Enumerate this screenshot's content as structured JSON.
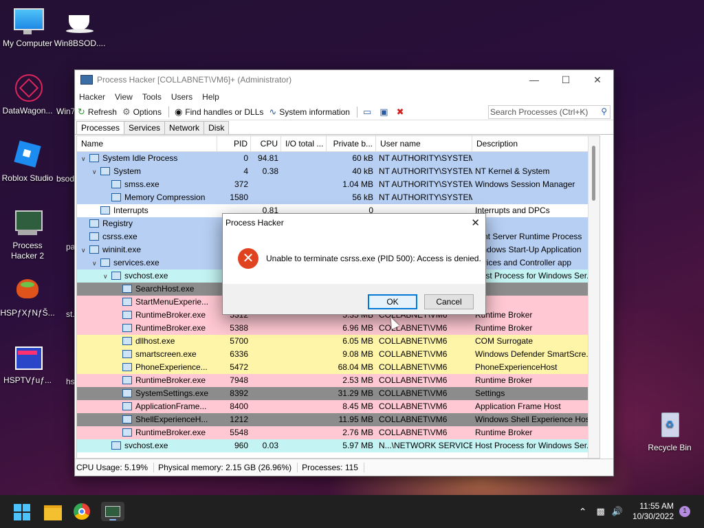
{
  "desktop": {
    "icons": [
      {
        "label": "My Computer"
      },
      {
        "label": "Win8BSOD...."
      },
      {
        "label": "DataWagon..."
      },
      {
        "label": "Roblox Studio"
      },
      {
        "label": "Process Hacker 2"
      },
      {
        "label": "HSPƒXƒNƒŠ..."
      },
      {
        "label": "HSPTVƒuƒ..."
      },
      {
        "label": "Recycle Bin"
      }
    ],
    "partial_labels": [
      "Win7...",
      "bsod...",
      "pa...",
      "st...",
      "hs..."
    ]
  },
  "window": {
    "title": "Process Hacker [COLLABNET\\VM6]+ (Administrator)",
    "menu": [
      "Hacker",
      "View",
      "Tools",
      "Users",
      "Help"
    ],
    "toolbar": {
      "refresh": "Refresh",
      "options": "Options",
      "find_handles": "Find handles or DLLs",
      "system_info": "System information",
      "search_placeholder": "Search Processes (Ctrl+K)"
    },
    "tabs": [
      "Processes",
      "Services",
      "Network",
      "Disk"
    ],
    "columns": [
      "Name",
      "PID",
      "CPU",
      "I/O total ...",
      "Private b...",
      "User name",
      "Description"
    ],
    "rows": [
      {
        "name": "System Idle Process",
        "pid": "0",
        "cpu": "94.81",
        "io": "",
        "priv": "60 kB",
        "user": "NT AUTHORITY\\SYSTEM",
        "desc": "",
        "color": "#b7cff3",
        "indent": 0,
        "exp": "v"
      },
      {
        "name": "System",
        "pid": "4",
        "cpu": "0.38",
        "io": "",
        "priv": "40 kB",
        "user": "NT AUTHORITY\\SYSTEM",
        "desc": "NT Kernel & System",
        "color": "#b7cff3",
        "indent": 1,
        "exp": "v"
      },
      {
        "name": "smss.exe",
        "pid": "372",
        "cpu": "",
        "io": "",
        "priv": "1.04 MB",
        "user": "NT AUTHORITY\\SYSTEM",
        "desc": "Windows Session Manager",
        "color": "#b7cff3",
        "indent": 2,
        "exp": ""
      },
      {
        "name": "Memory Compression",
        "pid": "1580",
        "cpu": "",
        "io": "",
        "priv": "56 kB",
        "user": "NT AUTHORITY\\SYSTEM",
        "desc": "",
        "color": "#b7cff3",
        "indent": 2,
        "exp": ""
      },
      {
        "name": "Interrupts",
        "pid": "",
        "cpu": "0.81",
        "io": "",
        "priv": "0",
        "user": "",
        "desc": "Interrupts and DPCs",
        "color": "#ffffff",
        "indent": 1,
        "exp": ""
      },
      {
        "name": "Registry",
        "pid": "",
        "cpu": "",
        "io": "",
        "priv": "",
        "user": "",
        "desc": "",
        "color": "#b7cff3",
        "indent": 0,
        "exp": ""
      },
      {
        "name": "csrss.exe",
        "pid": "",
        "cpu": "",
        "io": "",
        "priv": "",
        "user": "",
        "desc": "lient Server Runtime Process",
        "color": "#b7cff3",
        "indent": 0,
        "exp": ""
      },
      {
        "name": "wininit.exe",
        "pid": "",
        "cpu": "",
        "io": "",
        "priv": "",
        "user": "",
        "desc": "Vindows Start-Up Application",
        "color": "#b7cff3",
        "indent": 0,
        "exp": "v"
      },
      {
        "name": "services.exe",
        "pid": "",
        "cpu": "",
        "io": "",
        "priv": "",
        "user": "",
        "desc": "ervices and Controller app",
        "color": "#b7cff3",
        "indent": 1,
        "exp": "v"
      },
      {
        "name": "svchost.exe",
        "pid": "",
        "cpu": "",
        "io": "",
        "priv": "",
        "user": "",
        "desc": "Host Process for Windows Ser...",
        "color": "#c4f3f3",
        "indent": 2,
        "exp": "v"
      },
      {
        "name": "SearchHost.exe",
        "pid": "",
        "cpu": "",
        "io": "",
        "priv": "",
        "user": "",
        "desc": "",
        "color": "#8c8c8c",
        "indent": 3,
        "exp": ""
      },
      {
        "name": "StartMenuExperie...",
        "pid": "",
        "cpu": "",
        "io": "",
        "priv": "",
        "user": "",
        "desc": "",
        "color": "#ffc8d2",
        "indent": 3,
        "exp": ""
      },
      {
        "name": "RuntimeBroker.exe",
        "pid": "5312",
        "cpu": "",
        "io": "",
        "priv": "5.35 MB",
        "user": "COLLABNET\\VM6",
        "desc": "Runtime Broker",
        "color": "#ffc8d2",
        "indent": 3,
        "exp": ""
      },
      {
        "name": "RuntimeBroker.exe",
        "pid": "5388",
        "cpu": "",
        "io": "",
        "priv": "6.96 MB",
        "user": "COLLABNET\\VM6",
        "desc": "Runtime Broker",
        "color": "#ffc8d2",
        "indent": 3,
        "exp": ""
      },
      {
        "name": "dllhost.exe",
        "pid": "5700",
        "cpu": "",
        "io": "",
        "priv": "6.05 MB",
        "user": "COLLABNET\\VM6",
        "desc": "COM Surrogate",
        "color": "#fff5a8",
        "indent": 3,
        "exp": ""
      },
      {
        "name": "smartscreen.exe",
        "pid": "6336",
        "cpu": "",
        "io": "",
        "priv": "9.08 MB",
        "user": "COLLABNET\\VM6",
        "desc": "Windows Defender SmartScre...",
        "color": "#fff5a8",
        "indent": 3,
        "exp": ""
      },
      {
        "name": "PhoneExperience...",
        "pid": "5472",
        "cpu": "",
        "io": "",
        "priv": "68.04 MB",
        "user": "COLLABNET\\VM6",
        "desc": "PhoneExperienceHost",
        "color": "#fff5a8",
        "indent": 3,
        "exp": ""
      },
      {
        "name": "RuntimeBroker.exe",
        "pid": "7948",
        "cpu": "",
        "io": "",
        "priv": "2.53 MB",
        "user": "COLLABNET\\VM6",
        "desc": "Runtime Broker",
        "color": "#ffc8d2",
        "indent": 3,
        "exp": ""
      },
      {
        "name": "SystemSettings.exe",
        "pid": "8392",
        "cpu": "",
        "io": "",
        "priv": "31.29 MB",
        "user": "COLLABNET\\VM6",
        "desc": "Settings",
        "color": "#8c8c8c",
        "indent": 3,
        "exp": ""
      },
      {
        "name": "ApplicationFrame...",
        "pid": "8400",
        "cpu": "",
        "io": "",
        "priv": "8.45 MB",
        "user": "COLLABNET\\VM6",
        "desc": "Application Frame Host",
        "color": "#ffc8d2",
        "indent": 3,
        "exp": ""
      },
      {
        "name": "ShellExperienceH...",
        "pid": "1212",
        "cpu": "",
        "io": "",
        "priv": "11.95 MB",
        "user": "COLLABNET\\VM6",
        "desc": "Windows Shell Experience Host",
        "color": "#8c8c8c",
        "indent": 3,
        "exp": ""
      },
      {
        "name": "RuntimeBroker.exe",
        "pid": "5548",
        "cpu": "",
        "io": "",
        "priv": "2.76 MB",
        "user": "COLLABNET\\VM6",
        "desc": "Runtime Broker",
        "color": "#ffc8d2",
        "indent": 3,
        "exp": ""
      },
      {
        "name": "svchost.exe",
        "pid": "960",
        "cpu": "0.03",
        "io": "",
        "priv": "5.97 MB",
        "user": "N...\\NETWORK SERVICE",
        "desc": "Host Process for Windows Ser...",
        "color": "#c4f3f3",
        "indent": 2,
        "exp": ""
      }
    ],
    "status": {
      "cpu": "CPU Usage: 5.19%",
      "mem": "Physical memory: 2.15 GB (26.96%)",
      "procs": "Processes: 115"
    }
  },
  "dialog": {
    "title": "Process Hacker",
    "message": "Unable to terminate csrss.exe (PID 500): Access is denied.",
    "ok": "OK",
    "cancel": "Cancel"
  },
  "taskbar": {
    "time": "11:55 AM",
    "date": "10/30/2022",
    "notification_count": "1"
  }
}
